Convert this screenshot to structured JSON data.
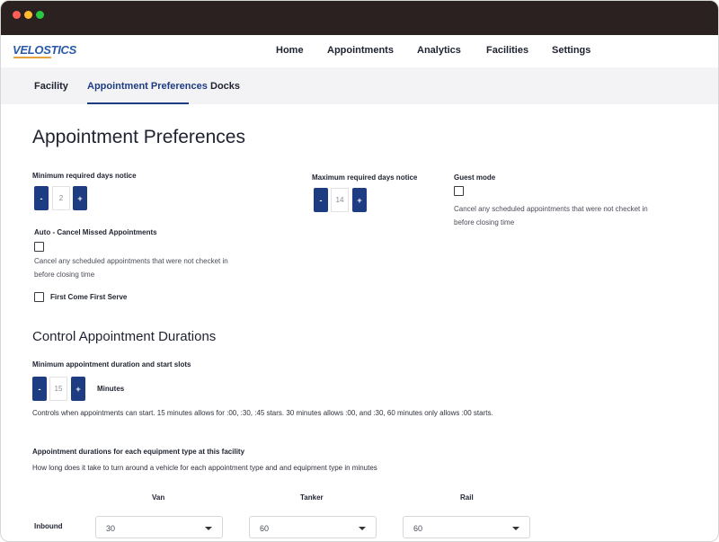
{
  "app": {
    "logo_text": "VELOSTICS"
  },
  "nav": {
    "home": "Home",
    "appointments": "Appointments",
    "analytics": "Analytics",
    "facilities": "Facilities",
    "settings": "Settings"
  },
  "tabs": {
    "facility": "Facility",
    "appointment_preferences": "Appointment Preferences",
    "docks": "Docks"
  },
  "page": {
    "title": "Appointment Preferences"
  },
  "min_days": {
    "label": "Minimum required days notice",
    "minus": "-",
    "value": "2",
    "plus": "+"
  },
  "max_days": {
    "label": "Maximum required days notice",
    "minus": "-",
    "value": "14",
    "plus": "+"
  },
  "guest_mode": {
    "label": "Guest mode",
    "help_1": "Cancel any scheduled appointments that were not  checket in",
    "help_2": "before closing time",
    "checked": false
  },
  "auto_cancel": {
    "label": "Auto - Cancel Missed Appointments",
    "help_1": "Cancel any scheduled appointments that were not  checket in",
    "help_2": "before closing time",
    "checked": false
  },
  "first_come": {
    "label": "First Come First Serve",
    "checked": false
  },
  "durations": {
    "title": "Control Appointment Durations",
    "min_label": "Minimum appointment duration and start slots",
    "minus": "-",
    "value": "15",
    "plus": "+",
    "unit": "Minutes",
    "help": "Controls when appointments can start. 15 minutes allows for :00, :30, :45 stars. 30 minutes allows :00, and  :30, 60 minutes only allows :00 starts."
  },
  "equipment": {
    "label": "Appointment  durations for each  equipment type  at this facility",
    "help": "How long does it take to turn around a vehicle for each appointment type and and equipment type in minutes",
    "columns": [
      "Van",
      "Tanker",
      "Rail"
    ],
    "rows": [
      {
        "label": "Inbound",
        "values": [
          "30",
          "60",
          "60"
        ]
      }
    ]
  }
}
